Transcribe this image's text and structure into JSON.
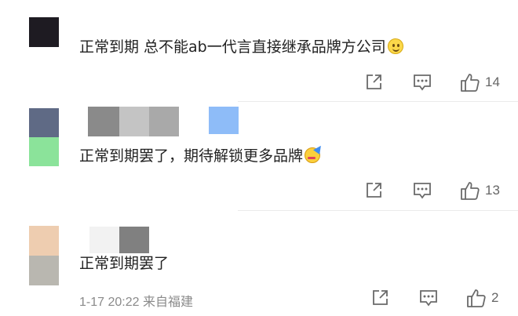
{
  "comments": [
    {
      "text": "正常到期 总不能ab一代言直接继承品牌方公司",
      "emoji": "slightly-smiling-face-emoji",
      "actions": {
        "share_icon": "share-icon",
        "reply_icon": "comment-icon",
        "like_icon": "thumbs-up-icon",
        "like_count": "14"
      }
    },
    {
      "text": "正常到期罢了，期待解锁更多品牌",
      "emoji": "partying-face-emoji",
      "actions": {
        "share_icon": "share-icon",
        "reply_icon": "comment-icon",
        "like_icon": "thumbs-up-icon",
        "like_count": "13"
      }
    },
    {
      "text": "正常到期罢了",
      "meta": "1-17 20:22  来自福建",
      "actions": {
        "share_icon": "share-icon",
        "reply_icon": "comment-icon",
        "like_icon": "thumbs-up-icon",
        "like_count": "2"
      }
    }
  ],
  "colors": {
    "text": "#222222",
    "icon": "#6a6a6a",
    "count": "#666666",
    "meta": "#8a8a8a"
  }
}
